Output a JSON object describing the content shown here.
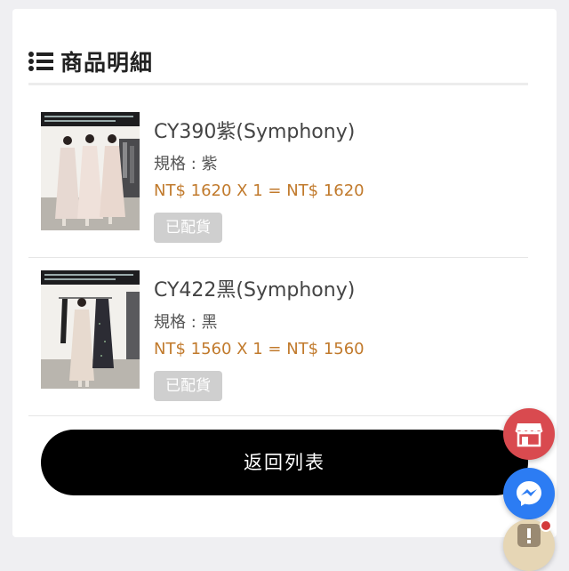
{
  "section": {
    "title": "商品明細",
    "icon": "list-icon"
  },
  "items": [
    {
      "name": "CY390紫(Symphony)",
      "spec": "規格 : 紫",
      "price": "NT$ 1620 X 1 = NT$ 1620",
      "status": "已配貨",
      "thumbnail_icon": "product-photo-dresses"
    },
    {
      "name": "CY422黑(Symphony)",
      "spec": "規格 : 黑",
      "price": "NT$ 1560 X 1 = NT$ 1560",
      "status": "已配貨",
      "thumbnail_icon": "product-photo-dresses"
    }
  ],
  "back_button_label": "返回列表",
  "floating_buttons": [
    {
      "name": "store",
      "icon": "store-icon",
      "color": "#d94a4f"
    },
    {
      "name": "messenger",
      "icon": "messenger-icon",
      "color": "#2c7cf3"
    },
    {
      "name": "alert",
      "icon": "exclamation-icon",
      "color": "#e6d6b5"
    }
  ],
  "colors": {
    "price": "#c17a2c",
    "badge": "#cfcfcf",
    "button": "#000000"
  }
}
